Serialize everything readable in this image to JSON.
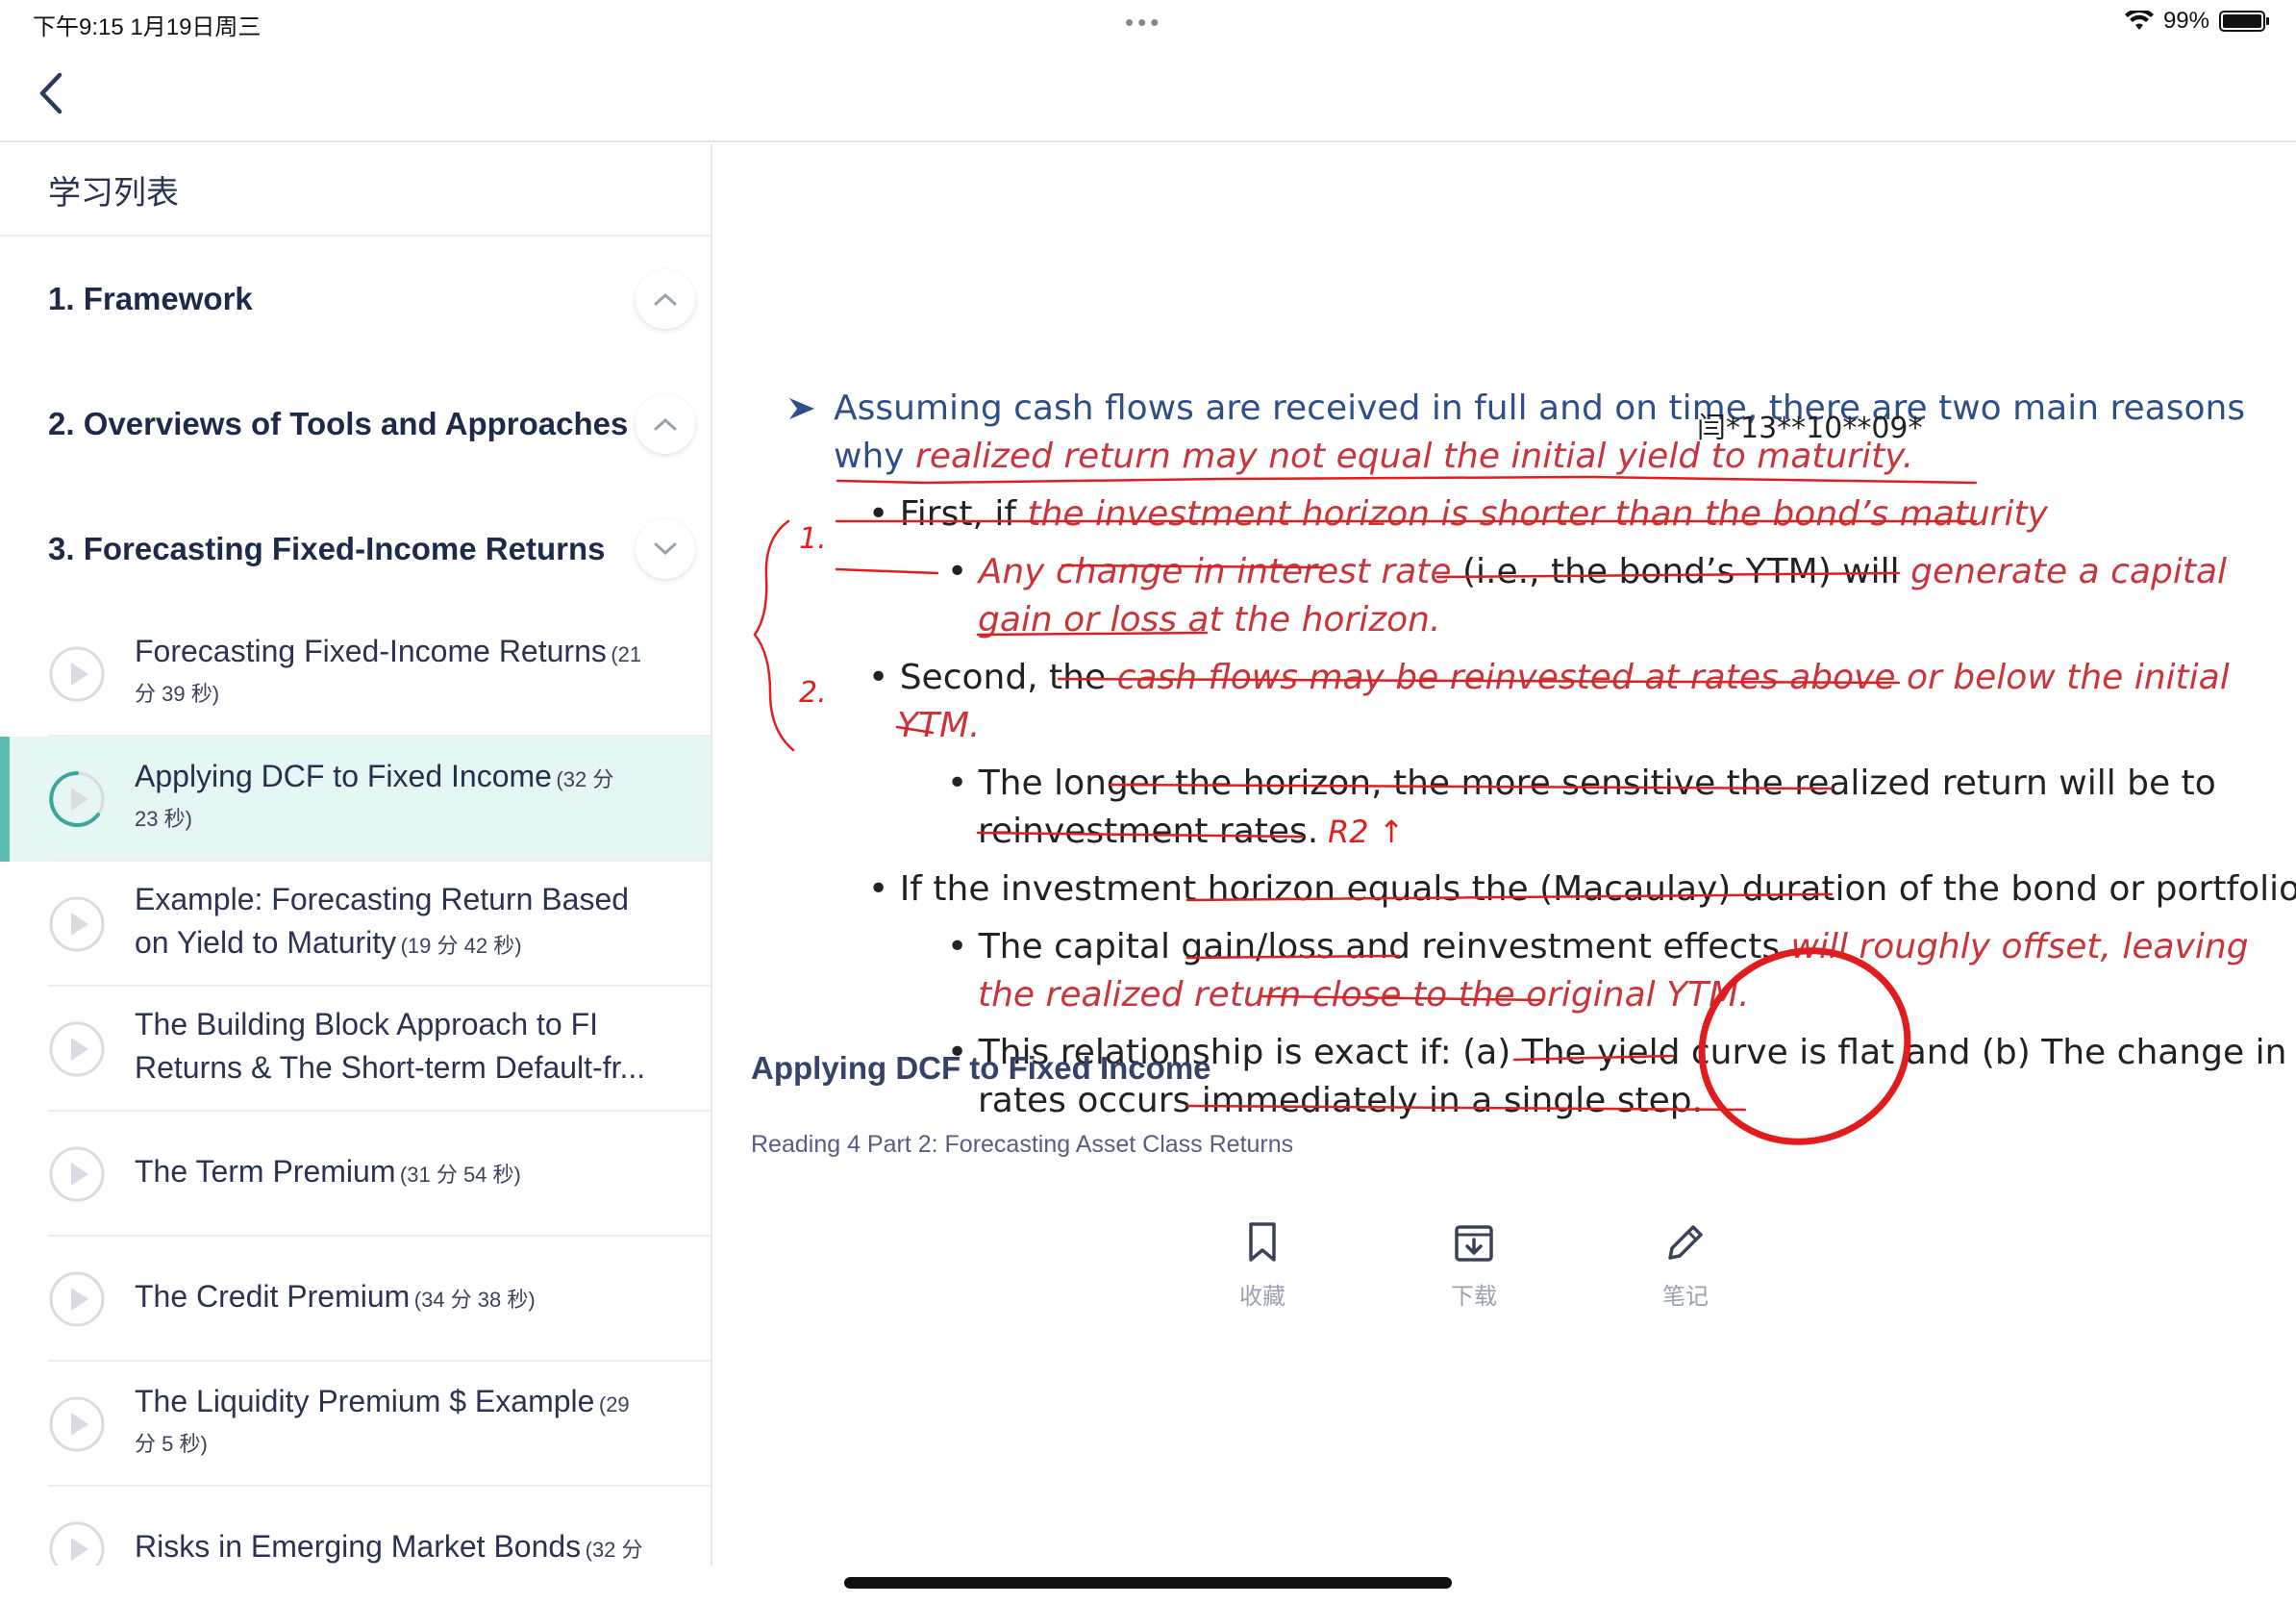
{
  "status_bar": {
    "time": "下午9:15   1月19日周三",
    "dots": "•••",
    "battery": "99%",
    "battery_level": 0.99
  },
  "sidebar": {
    "title": "学习列表",
    "chapters": [
      {
        "label": "1. Framework",
        "icon": "chevron-up-icon"
      },
      {
        "label": "2. Overviews of Tools and Approaches",
        "icon": "chevron-up-icon"
      },
      {
        "label": "3. Forecasting Fixed-Income Returns",
        "icon": "chevron-down-icon"
      }
    ],
    "lessons": [
      {
        "title": "Forecasting Fixed-Income Returns",
        "duration_a": "(21",
        "duration_b": "分 39 秒)"
      },
      {
        "title": "Applying DCF to Fixed Income",
        "duration_a": "(32 分",
        "duration_b": "23 秒)",
        "active": true
      },
      {
        "title": "Example: Forecasting Return Based",
        "title2": "on Yield to Maturity",
        "duration": "(19 分 42 秒)"
      },
      {
        "title": "The Building Block Approach to FI",
        "title2": "Returns & The Short-term Default-fr..."
      },
      {
        "title": "The Term Premium",
        "duration": "(31 分 54 秒)"
      },
      {
        "title": "The Credit Premium",
        "duration": "(34 分 38 秒)"
      },
      {
        "title": "The Liquidity Premium $ Example",
        "duration_a": "(29",
        "duration_b": "分 5 秒)"
      },
      {
        "title": "Risks in Emerging Market Bonds",
        "duration_a": "(32 分",
        "duration_b": ""
      }
    ]
  },
  "slide": {
    "line1": "Assuming cash flows are received in full and on time, there are two main reasons",
    "line2a": "why ",
    "line2b": "realized return may not equal the initial yield to maturity.",
    "b1a": "First, if ",
    "b1b": "the investment horizon is shorter than the bond’s maturity",
    "b1_1a": "Any change in interest rate",
    "b1_1b": " (i.e., the bond’s YTM) will ",
    "b1_1c": "generate a capital",
    "b1_1d": "gain or loss at the horizon.",
    "b2a": "Second, the ",
    "b2b": "cash flows may be reinvested at rates above or below the initial",
    "b2c": "YTM.",
    "b2_1a": "The longer the horizon, the more sensitive the realized return will be to",
    "b2_1b": "reinvestment rates.",
    "b3": "If the investment horizon equals the (Macaulay) duration of the bond or portfolio",
    "b3_1a": "The capital gain/loss and reinvestment effects ",
    "b3_1b": "will roughly offset, leaving",
    "b3_1c": "the realized return close to the original YTM.",
    "b3_2a": "This relationship is exact if: (a) The yield curve is flat and (b) The change in",
    "b3_2b": "rates occurs immediately in a single step.",
    "watermark": "闫*13**10**09*",
    "note1": "1.",
    "note2": "2.",
    "note3": "R2  ↑"
  },
  "video": {
    "title": "Applying DCF to Fixed Income",
    "subtitle": "Reading 4 Part 2: Forecasting Asset Class Returns"
  },
  "actions": [
    {
      "label": "收藏",
      "icon": "bookmark-icon"
    },
    {
      "label": "下载",
      "icon": "download-icon"
    },
    {
      "label": "笔记",
      "icon": "pencil-icon"
    }
  ],
  "colors": {
    "accent": "#5cbcb2",
    "active_bg": "#e6f6f5",
    "annotation": "#e02020"
  }
}
